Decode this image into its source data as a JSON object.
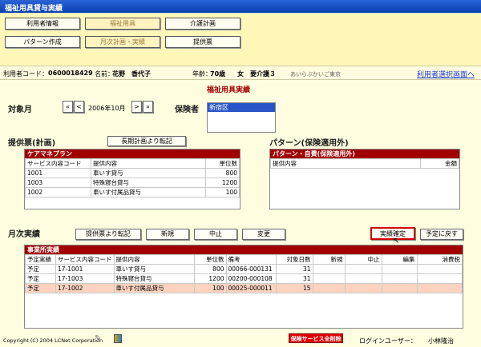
{
  "title": "福祉用具貸与実績",
  "nav": {
    "user_info": "利用者情報",
    "welfare": "福祉用具",
    "care_plan": "介護計画",
    "pattern": "パターン作成",
    "monthly": "月次計画・実績",
    "ticket": "提供票"
  },
  "user": {
    "code_label": "利用者コード：",
    "code": "0600018429",
    "name_label": "名前：",
    "name": "花野　香代子",
    "age_label": "年齢：",
    "age": "70歳",
    "sex": "女",
    "care_level": "要介護３",
    "location": "あいらぶかいご東京",
    "select_link": "利用者選択画面へ"
  },
  "page_heading": "福祉用具実績",
  "target": {
    "label": "対象月",
    "first": "«",
    "prev": "<",
    "month": "2006年10月",
    "next": ">",
    "last": "»"
  },
  "insurer": {
    "label": "保険者",
    "selected": "新宿区"
  },
  "ticket_section": {
    "label": "提供票(計画)",
    "transfer_button": "長期計画より転記",
    "panel_title": "ケアマネプラン",
    "cols": [
      "サービス内容コード",
      "提供内容",
      "単位数"
    ],
    "rows": [
      [
        "1001",
        "車いす貸与",
        "800"
      ],
      [
        "1003",
        "特殊寝台貸与",
        "1200"
      ],
      [
        "1002",
        "車いす付属品貸与",
        "100"
      ]
    ]
  },
  "pattern_section": {
    "label": "パターン(保険適用外)",
    "panel_title": "パターン・自費(保険適用外)",
    "cols": [
      "提供内容",
      "金額"
    ]
  },
  "monthly_section": {
    "label": "月次実績",
    "buttons": {
      "transfer": "提供票より転記",
      "new": "新規",
      "stop": "中止",
      "change": "変更",
      "confirm": "実績確定",
      "back": "予定に戻す"
    },
    "panel_title": "事業所実績",
    "cols": [
      "予定実績",
      "サービス内容コード",
      "提供内容",
      "単位数",
      "備考",
      "対象日数",
      "新規",
      "中止",
      "編集",
      "消費税"
    ],
    "rows": [
      [
        "予定",
        "17-1001",
        "車いす貸与",
        "800",
        "00066-000131",
        "31",
        "",
        "",
        "",
        ""
      ],
      [
        "予定",
        "17-1003",
        "特殊寝台貸与",
        "1200",
        "00200-000108",
        "31",
        "",
        "",
        "",
        ""
      ],
      [
        "予定",
        "17-1002",
        "車いす付属品貸与",
        "100",
        "00025-000011",
        "15",
        "",
        "",
        "",
        ""
      ]
    ]
  },
  "footer": {
    "copyright": "Copyright (C) 2004 LCNet Corporation",
    "delete_all": "保険サービス全削除",
    "login_label": "ログインユーザー：",
    "login_user": "小林隆治"
  },
  "colors": {
    "title_bar": "#0a3fb0",
    "panel_header": "#a00000",
    "selected_row": "#fcd3c0",
    "confirm_border": "#d00000"
  }
}
